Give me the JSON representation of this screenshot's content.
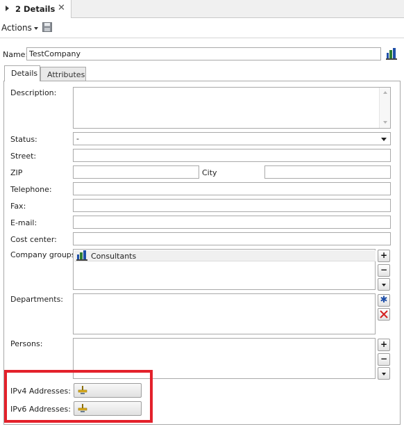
{
  "doc_tab": {
    "title": "2 Details",
    "close": "✕"
  },
  "toolbar": {
    "actions_label": "Actions"
  },
  "name": {
    "label": "Name:",
    "value": "TestCompany"
  },
  "tabs": [
    {
      "label": "Details"
    },
    {
      "label": "Attributes"
    }
  ],
  "form": {
    "description_label": "Description:",
    "status_label": "Status:",
    "status_value": "-",
    "street_label": "Street:",
    "zip_label": "ZIP",
    "city_label": "City",
    "telephone_label": "Telephone:",
    "fax_label": "Fax:",
    "email_label": "E-mail:",
    "cost_center_label": "Cost center:",
    "company_groups_label": "Company groups:",
    "company_groups": [
      "Consultants"
    ],
    "departments_label": "Departments:",
    "persons_label": "Persons:",
    "ipv4_label": "IPv4 Addresses:",
    "ipv6_label": "IPv6 Addresses:"
  },
  "buttons": {
    "add": "+",
    "remove": "−"
  },
  "colors": {
    "highlight": "#e3212b",
    "icon_blue": "#1f4fa8",
    "icon_red": "#d42020"
  }
}
